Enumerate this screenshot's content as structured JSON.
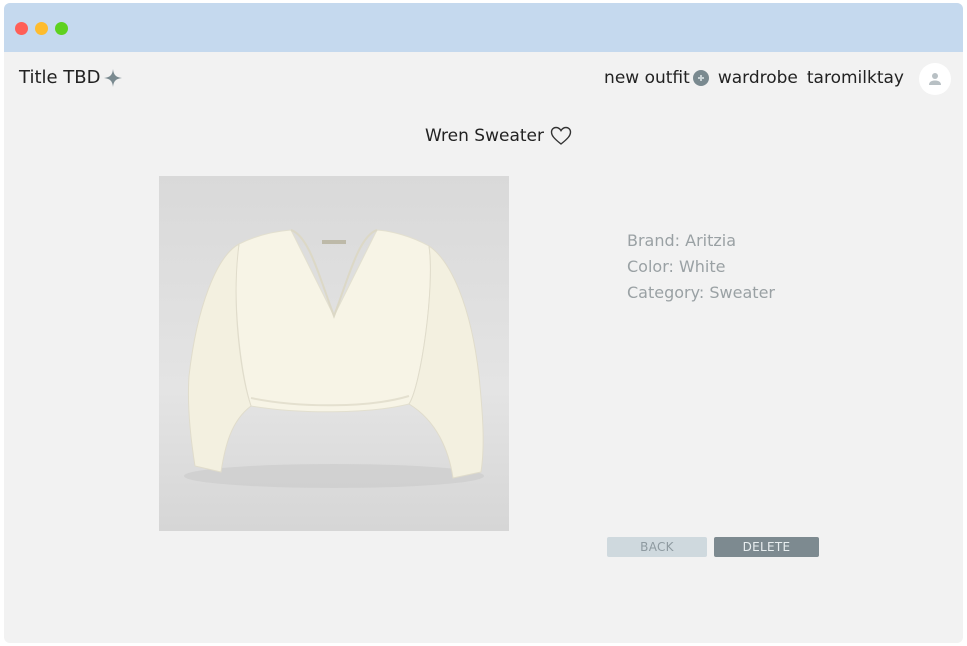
{
  "app": {
    "name": "Title TBD"
  },
  "nav": {
    "new_outfit": "new outfit",
    "wardrobe": "wardrobe",
    "username": "taromilktay"
  },
  "item": {
    "name": "Wren Sweater",
    "details": [
      "Brand: Aritzia",
      "Color: White",
      "Category: Sweater"
    ]
  },
  "buttons": {
    "back": "BACK",
    "delete": "DELETE"
  },
  "colors": {
    "titlebar": "#c5d9ee",
    "background": "#f2f2f2",
    "accent": "#7d8a90",
    "sweater": "#f7f4e6"
  },
  "icons": {
    "logo": "sparkle-icon",
    "add": "plus-circle-icon",
    "user": "user-icon",
    "favorite": "heart-icon"
  }
}
